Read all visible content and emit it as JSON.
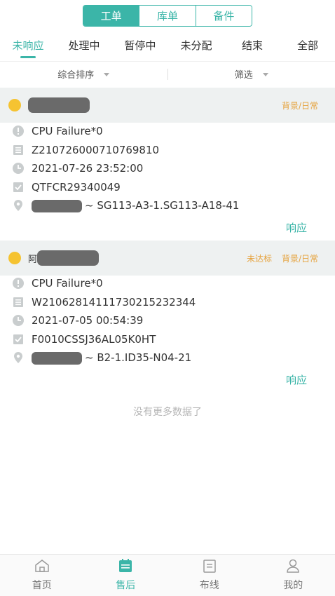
{
  "segments": [
    {
      "label": "工单",
      "active": true
    },
    {
      "label": "库单",
      "active": false
    },
    {
      "label": "备件",
      "active": false
    }
  ],
  "tabs": [
    {
      "label": "未响应",
      "active": true
    },
    {
      "label": "处理中",
      "active": false
    },
    {
      "label": "暂停中",
      "active": false
    },
    {
      "label": "未分配",
      "active": false
    },
    {
      "label": "结束",
      "active": false
    },
    {
      "label": "全部",
      "active": false
    }
  ],
  "sort": {
    "sort_label": "综合排序",
    "filter_label": "筛选"
  },
  "orders": [
    {
      "name_prefix": "",
      "tags": [
        "背景/日常"
      ],
      "fault": "CPU Failure*0",
      "order_no": "Z210726000710769810",
      "time": "2021-07-26 23:52:00",
      "serial": "QTFCR29340049",
      "location": "~ SG113-A3-1.SG113-A18-41",
      "action": "响应"
    },
    {
      "name_prefix": "阿",
      "tags": [
        "未达标",
        "背景/日常"
      ],
      "fault": "CPU Failure*0",
      "order_no": "W21062814111730215232344",
      "time": "2021-07-05 00:54:39",
      "serial": "F0010CSSJ36AL05K0HT",
      "location": "~ B2-1.ID35-N04-21",
      "action": "响应"
    }
  ],
  "empty_hint": "没有更多数据了",
  "bottom_nav": [
    {
      "label": "首页",
      "icon": "home-icon",
      "active": false
    },
    {
      "label": "售后",
      "icon": "after-sales-icon",
      "active": true
    },
    {
      "label": "布线",
      "icon": "wiring-icon",
      "active": false
    },
    {
      "label": "我的",
      "icon": "profile-icon",
      "active": false
    }
  ],
  "colors": {
    "accent": "#3bb5a8",
    "tag": "#e6a23c",
    "dot": "#f5c331"
  }
}
